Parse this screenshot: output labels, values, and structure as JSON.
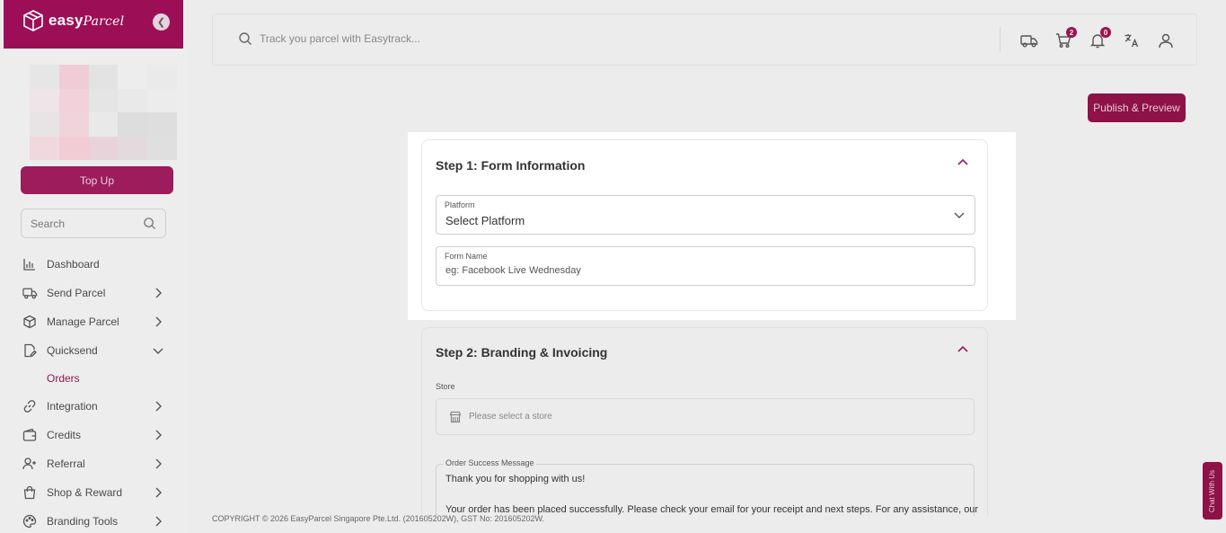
{
  "brand": {
    "name": "easy",
    "script": "Parcel",
    "accent": "#9c0f56"
  },
  "sidebar": {
    "topup_label": "Top Up",
    "search_placeholder": "Search",
    "items": [
      {
        "label": "Dashboard",
        "icon": "bar-chart-icon",
        "has_chevron": false
      },
      {
        "label": "Send Parcel",
        "icon": "truck-icon",
        "has_chevron": true
      },
      {
        "label": "Manage Parcel",
        "icon": "box-icon",
        "has_chevron": true
      },
      {
        "label": "Quicksend",
        "icon": "document-edit-icon",
        "has_chevron": true,
        "expanded": true
      },
      {
        "label": "Integration",
        "icon": "link-icon",
        "has_chevron": true
      },
      {
        "label": "Credits",
        "icon": "wallet-icon",
        "has_chevron": true
      },
      {
        "label": "Referral",
        "icon": "user-add-icon",
        "has_chevron": true
      },
      {
        "label": "Shop & Reward",
        "icon": "shopping-bag-icon",
        "has_chevron": true
      },
      {
        "label": "Branding Tools",
        "icon": "palette-icon",
        "has_chevron": true
      }
    ],
    "subitem": "Orders"
  },
  "topbar": {
    "track_placeholder": "Track you parcel with Easytrack...",
    "cart_badge": "2",
    "notification_badge": "0"
  },
  "publish_label": "Publish & Preview",
  "step1": {
    "title": "Step 1: Form Information",
    "platform_label": "Platform",
    "platform_value": "Select Platform",
    "form_name_label": "Form Name",
    "form_name_placeholder": "eg: Facebook Live Wednesday"
  },
  "step2": {
    "title": "Step 2: Branding & Invoicing",
    "store_label": "Store",
    "store_placeholder": "Please select a store",
    "message_label": "Order Success Message",
    "message_line1": "Thank you for shopping with us!",
    "message_line2": "Your order has been placed successfully. Please check your email for your receipt and next steps. For any assistance, our"
  },
  "footer": "COPYRIGHT © 2026 EasyParcel Singapore Pte.Ltd. (201605202W), GST No: 201605202W.",
  "chat_label": "Chat With Us"
}
